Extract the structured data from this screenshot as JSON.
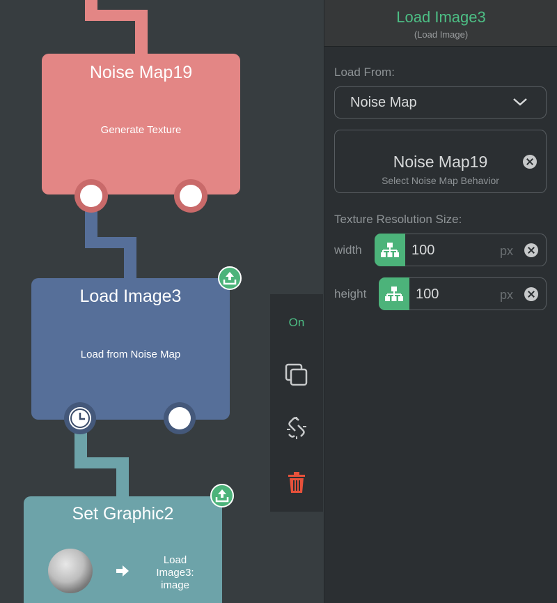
{
  "canvas": {
    "nodes": [
      {
        "title": "Noise Map19",
        "subtitle": "Generate Texture",
        "color": "#e38685"
      },
      {
        "title": "Load Image3",
        "subtitle": "Load from Noise Map",
        "color": "#566f99"
      },
      {
        "title": "Set Graphic2",
        "subtitle": "Load Image3: image",
        "color": "#6da3a9"
      }
    ],
    "wire_colors": {
      "red": "#e38685",
      "blue": "#566f99",
      "teal": "#6da3a9"
    }
  },
  "toolbar": {
    "toggle_label": "On",
    "icons": [
      "duplicate-icon",
      "unlink-icon",
      "trash-icon"
    ],
    "delete_color": "#e7513b"
  },
  "panel": {
    "title": "Load Image3",
    "subtitle": "(Load Image)",
    "load_from_label": "Load From:",
    "load_from_value": "Noise Map",
    "behavior": {
      "name": "Noise Map19",
      "hint": "Select Noise Map Behavior"
    },
    "texture_label": "Texture Resolution Size:",
    "width": {
      "label": "width",
      "value": "100",
      "unit": "px"
    },
    "height": {
      "label": "height",
      "value": "100",
      "unit": "px"
    },
    "accent": "#4dbf85"
  }
}
